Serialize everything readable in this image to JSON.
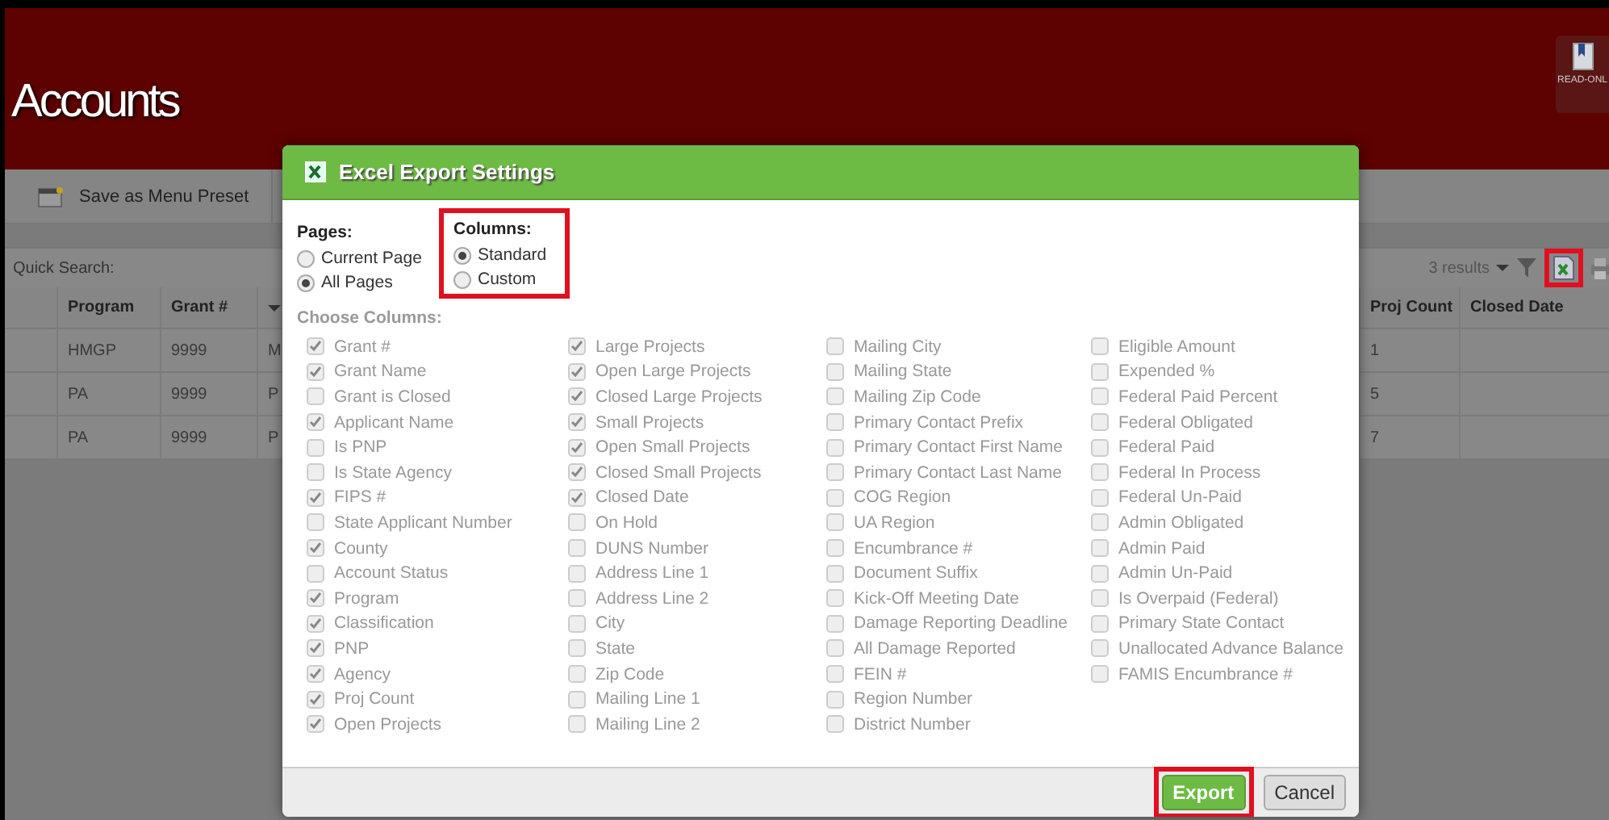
{
  "page": {
    "title": "Accounts",
    "read_only_label": "READ-ONL"
  },
  "toolbar": {
    "preset_button": "Save as Menu Preset"
  },
  "quick_search": {
    "label": "Quick Search:",
    "results": "3 results",
    "export_icon_highlighted": true
  },
  "table": {
    "left_columns": [
      "Program",
      "Grant #"
    ],
    "right_columns": [
      "Proj Count",
      "Closed Date"
    ],
    "rows": [
      {
        "program": "HMGP",
        "grant": "9999",
        "column_3": "M",
        "proj_count": "1"
      },
      {
        "program": "PA",
        "grant": "9999",
        "column_3": "P",
        "proj_count": "5"
      },
      {
        "program": "PA",
        "grant": "9999",
        "column_3": "P",
        "proj_count": "7"
      }
    ]
  },
  "dialog": {
    "title": "Excel Export Settings",
    "pages": {
      "label": "Pages:",
      "options": [
        {
          "label": "Current Page",
          "selected": false
        },
        {
          "label": "All Pages",
          "selected": true
        }
      ]
    },
    "columns": {
      "label": "Columns:",
      "highlighted": true,
      "options": [
        {
          "label": "Standard",
          "selected": true
        },
        {
          "label": "Custom",
          "selected": false
        }
      ]
    },
    "choose_label": "Choose Columns:",
    "column_lists": [
      [
        {
          "label": "Grant #",
          "checked": true
        },
        {
          "label": "Grant Name",
          "checked": true
        },
        {
          "label": "Grant is Closed",
          "checked": false
        },
        {
          "label": "Applicant Name",
          "checked": true
        },
        {
          "label": "Is PNP",
          "checked": false
        },
        {
          "label": "Is State Agency",
          "checked": false
        },
        {
          "label": "FIPS #",
          "checked": true
        },
        {
          "label": "State Applicant Number",
          "checked": false
        },
        {
          "label": "County",
          "checked": true
        },
        {
          "label": "Account Status",
          "checked": false
        },
        {
          "label": "Program",
          "checked": true
        },
        {
          "label": "Classification",
          "checked": true
        },
        {
          "label": "PNP",
          "checked": true
        },
        {
          "label": "Agency",
          "checked": true
        },
        {
          "label": "Proj Count",
          "checked": true
        },
        {
          "label": "Open Projects",
          "checked": true
        }
      ],
      [
        {
          "label": "Large Projects",
          "checked": true
        },
        {
          "label": "Open Large Projects",
          "checked": true
        },
        {
          "label": "Closed Large Projects",
          "checked": true
        },
        {
          "label": "Small Projects",
          "checked": true
        },
        {
          "label": "Open Small Projects",
          "checked": true
        },
        {
          "label": "Closed Small Projects",
          "checked": true
        },
        {
          "label": "Closed Date",
          "checked": true
        },
        {
          "label": "On Hold",
          "checked": false
        },
        {
          "label": "DUNS Number",
          "checked": false
        },
        {
          "label": "Address Line 1",
          "checked": false
        },
        {
          "label": "Address Line 2",
          "checked": false
        },
        {
          "label": "City",
          "checked": false
        },
        {
          "label": "State",
          "checked": false
        },
        {
          "label": "Zip Code",
          "checked": false
        },
        {
          "label": "Mailing Line 1",
          "checked": false
        },
        {
          "label": "Mailing Line 2",
          "checked": false
        }
      ],
      [
        {
          "label": "Mailing City",
          "checked": false
        },
        {
          "label": "Mailing State",
          "checked": false
        },
        {
          "label": "Mailing Zip Code",
          "checked": false
        },
        {
          "label": "Primary Contact Prefix",
          "checked": false
        },
        {
          "label": "Primary Contact First Name",
          "checked": false
        },
        {
          "label": "Primary Contact Last Name",
          "checked": false
        },
        {
          "label": "COG Region",
          "checked": false
        },
        {
          "label": "UA Region",
          "checked": false
        },
        {
          "label": "Encumbrance #",
          "checked": false
        },
        {
          "label": "Document Suffix",
          "checked": false
        },
        {
          "label": "Kick-Off Meeting Date",
          "checked": false
        },
        {
          "label": "Damage Reporting Deadline",
          "checked": false
        },
        {
          "label": "All Damage Reported",
          "checked": false
        },
        {
          "label": "FEIN #",
          "checked": false
        },
        {
          "label": "Region Number",
          "checked": false
        },
        {
          "label": "District Number",
          "checked": false
        }
      ],
      [
        {
          "label": "Eligible Amount",
          "checked": false
        },
        {
          "label": "Expended %",
          "checked": false
        },
        {
          "label": "Federal Paid Percent",
          "checked": false
        },
        {
          "label": "Federal Obligated",
          "checked": false
        },
        {
          "label": "Federal Paid",
          "checked": false
        },
        {
          "label": "Federal In Process",
          "checked": false
        },
        {
          "label": "Federal Un-Paid",
          "checked": false
        },
        {
          "label": "Admin Obligated",
          "checked": false
        },
        {
          "label": "Admin Paid",
          "checked": false
        },
        {
          "label": "Admin Un-Paid",
          "checked": false
        },
        {
          "label": "Is Overpaid (Federal)",
          "checked": false
        },
        {
          "label": "Primary State Contact",
          "checked": false
        },
        {
          "label": "Unallocated Advance Balance",
          "checked": false
        },
        {
          "label": "FAMIS Encumbrance #",
          "checked": false
        }
      ]
    ],
    "buttons": [
      {
        "label": "Export",
        "kind": "primary",
        "highlighted": true
      },
      {
        "label": "Cancel",
        "kind": "default",
        "highlighted": false
      }
    ]
  }
}
